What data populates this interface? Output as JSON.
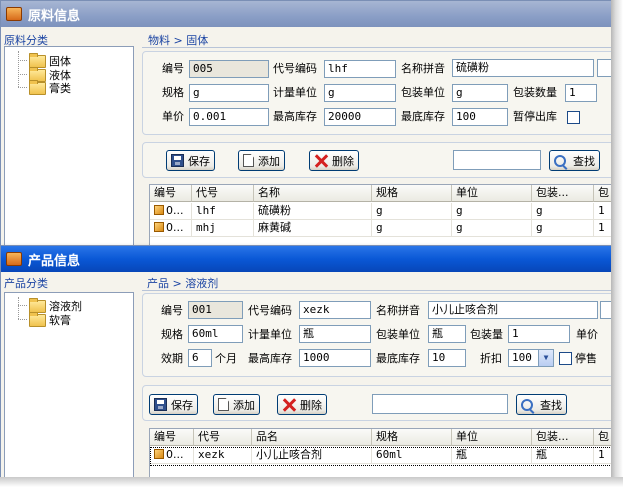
{
  "window1": {
    "title": "原料信息",
    "category_title": "原料分类",
    "tree": [
      "固体",
      "液体",
      "膏类"
    ],
    "breadcrumb": "物料 > 固体",
    "form": {
      "id_label": "编号",
      "id_value": "005",
      "code_label": "代号编码",
      "code_value": "lhf",
      "pinyin_label": "名称拼音",
      "pinyin_value": "硫磺粉",
      "spec_label": "规格",
      "spec_value": "g",
      "unit_label": "计量单位",
      "unit_value": "g",
      "pack_unit_label": "包装单位",
      "pack_unit_value": "g",
      "pack_qty_label": "包装数量",
      "pack_qty_value": "1",
      "price_label": "单价",
      "price_value": "0.001",
      "max_stock_label": "最高库存",
      "max_stock_value": "20000",
      "min_stock_label": "最底库存",
      "min_stock_value": "100",
      "stop_label": "暂停出库"
    },
    "toolbar": {
      "save": "保存",
      "add": "添加",
      "delete": "删除",
      "search": "查找",
      "search_value": ""
    },
    "grid": {
      "headers": [
        "编号",
        "代号",
        "名称",
        "规格",
        "单位",
        "包装...",
        "包"
      ],
      "rows": [
        [
          "0...",
          "lhf",
          "硫磺粉",
          "g",
          "g",
          "g",
          "1"
        ],
        [
          "0...",
          "mhj",
          "麻黄碱",
          "g",
          "g",
          "g",
          "1"
        ]
      ]
    }
  },
  "window2": {
    "title": "产品信息",
    "category_title": "产品分类",
    "tree": [
      "溶液剂",
      "软膏"
    ],
    "breadcrumb": "产品 > 溶液剂",
    "form": {
      "id_label": "编号",
      "id_value": "001",
      "code_label": "代号编码",
      "code_value": "xezk",
      "pinyin_label": "名称拼音",
      "pinyin_value": "小儿止咳合剂",
      "spec_label": "规格",
      "spec_value": "60ml",
      "unit_label": "计量单位",
      "unit_value": "瓶",
      "pack_unit_label": "包装单位",
      "pack_unit_value": "瓶",
      "pack_qty_label": "包装量",
      "pack_qty_value": "1",
      "price_label": "单价",
      "expiry_label": "效期",
      "expiry_value": "6",
      "expiry_unit": "个月",
      "max_stock_label": "最高库存",
      "max_stock_value": "1000",
      "min_stock_label": "最底库存",
      "min_stock_value": "10",
      "discount_label": "折扣",
      "discount_value": "100",
      "stop_label": "停售"
    },
    "toolbar": {
      "save": "保存",
      "add": "添加",
      "delete": "删除",
      "search": "查找",
      "search_value": ""
    },
    "grid": {
      "headers": [
        "编号",
        "代号",
        "品名",
        "规格",
        "单位",
        "包装...",
        "包"
      ],
      "rows": [
        [
          "0...",
          "xezk",
          "小儿止咳合剂",
          "60ml",
          "瓶",
          "瓶",
          "1"
        ]
      ]
    }
  },
  "colors": {
    "active_title": "#0a58d6",
    "inactive_title": "#8a9ec6",
    "link_blue": "#1c45a3",
    "panel_bg": "#f5f3ec"
  },
  "icons": [
    "window-icon",
    "folder-icon",
    "save-icon",
    "add-icon",
    "delete-icon",
    "search-icon",
    "item-icon"
  ]
}
